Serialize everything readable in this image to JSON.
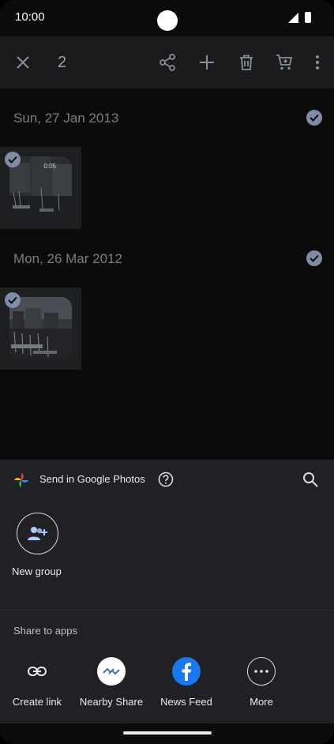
{
  "status_bar": {
    "time": "10:00"
  },
  "top_bar": {
    "selected_count": "2"
  },
  "sections": [
    {
      "date": "Sun, 27 Jan 2013",
      "item_duration": "0:05"
    },
    {
      "date": "Mon, 26 Mar 2012"
    }
  ],
  "share_sheet": {
    "title": "Send in Google Photos",
    "new_group_label": "New group",
    "share_to_apps_title": "Share to apps",
    "apps": [
      {
        "label": "Create link"
      },
      {
        "label": "Nearby Share"
      },
      {
        "label": "News Feed"
      },
      {
        "label": "More"
      }
    ]
  },
  "colors": {
    "selection_check": "#7e8da6",
    "sheet_bg": "#202124",
    "facebook_blue": "#1877f2"
  }
}
